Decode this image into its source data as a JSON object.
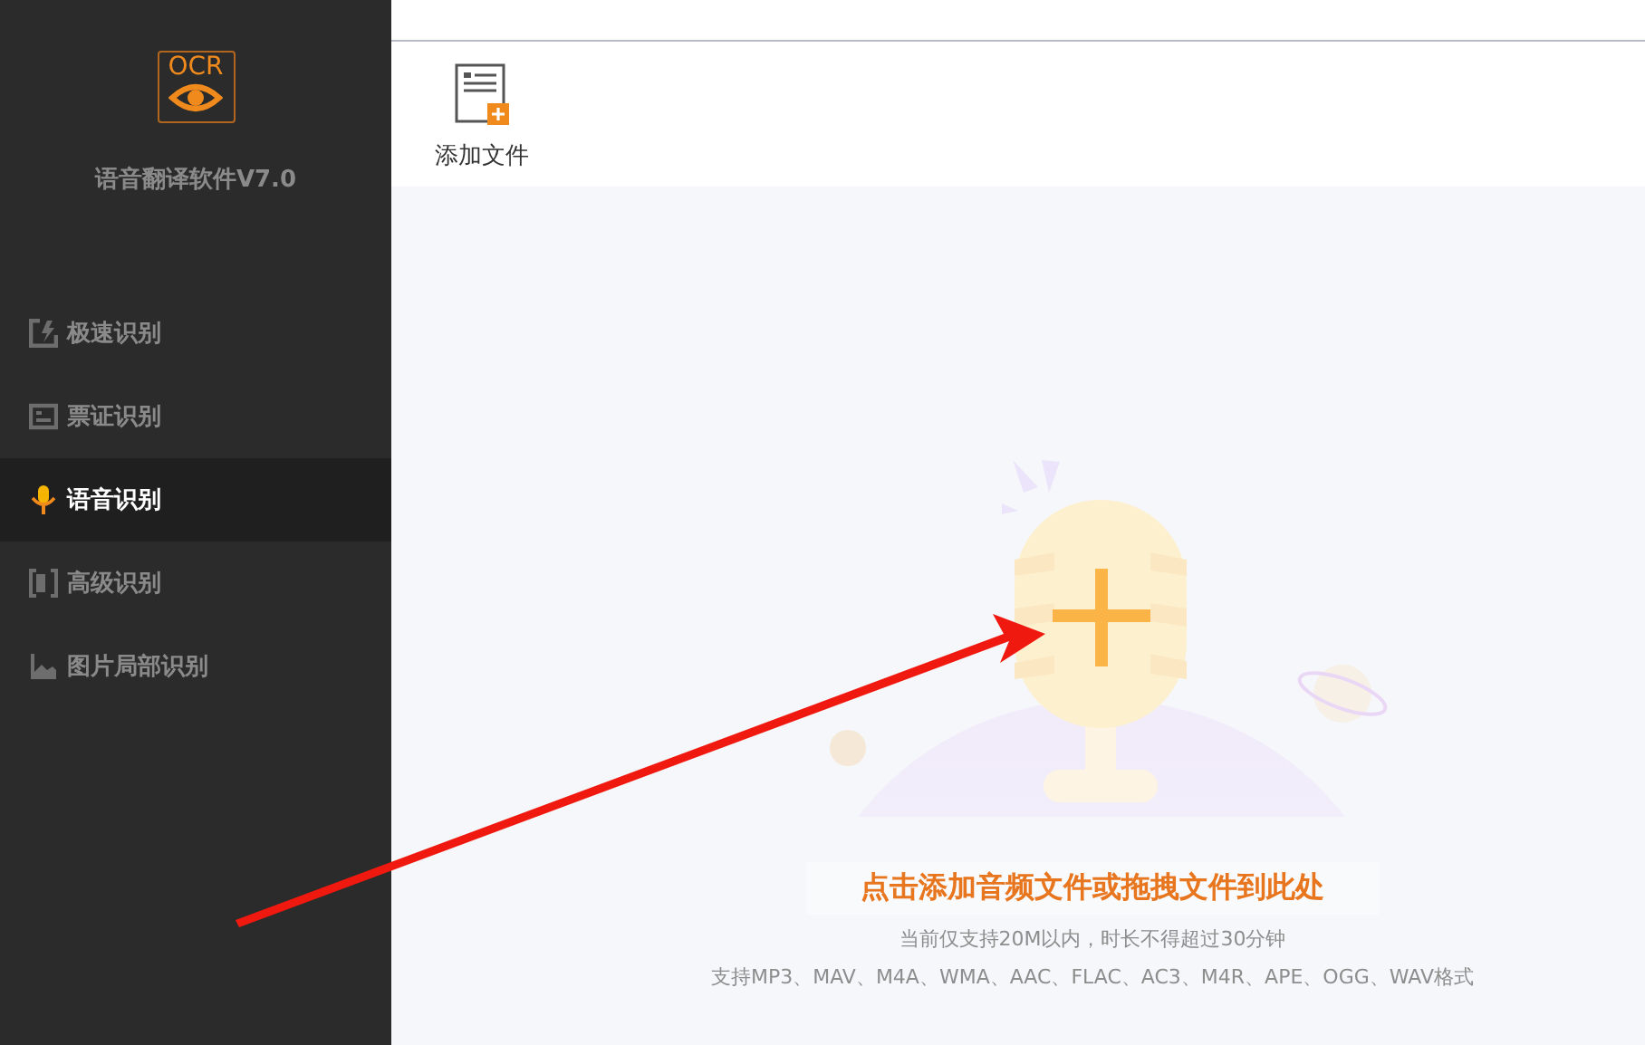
{
  "sidebar": {
    "logo_text": "OCR",
    "app_name": "语音翻译软件V7.0",
    "items": [
      {
        "label": "极速识别",
        "kind": "fast",
        "selected": false
      },
      {
        "label": "票证识别",
        "kind": "ticket",
        "selected": false
      },
      {
        "label": "语音识别",
        "kind": "voice",
        "selected": true
      },
      {
        "label": "高级识别",
        "kind": "advanced",
        "selected": false
      },
      {
        "label": "图片局部识别",
        "kind": "image",
        "selected": false
      }
    ]
  },
  "toolbar": {
    "buttons": [
      {
        "label": "添加文件"
      }
    ]
  },
  "drop_zone": {
    "title": "点击添加音频文件或拖拽文件到此处",
    "hints": [
      "当前仅支持20M以内，时长不得超过30分钟",
      "支持MP3、MAV、M4A、WMA、AAC、FLAC、AC3、M4R、APE、OGG、WAV格式"
    ]
  }
}
